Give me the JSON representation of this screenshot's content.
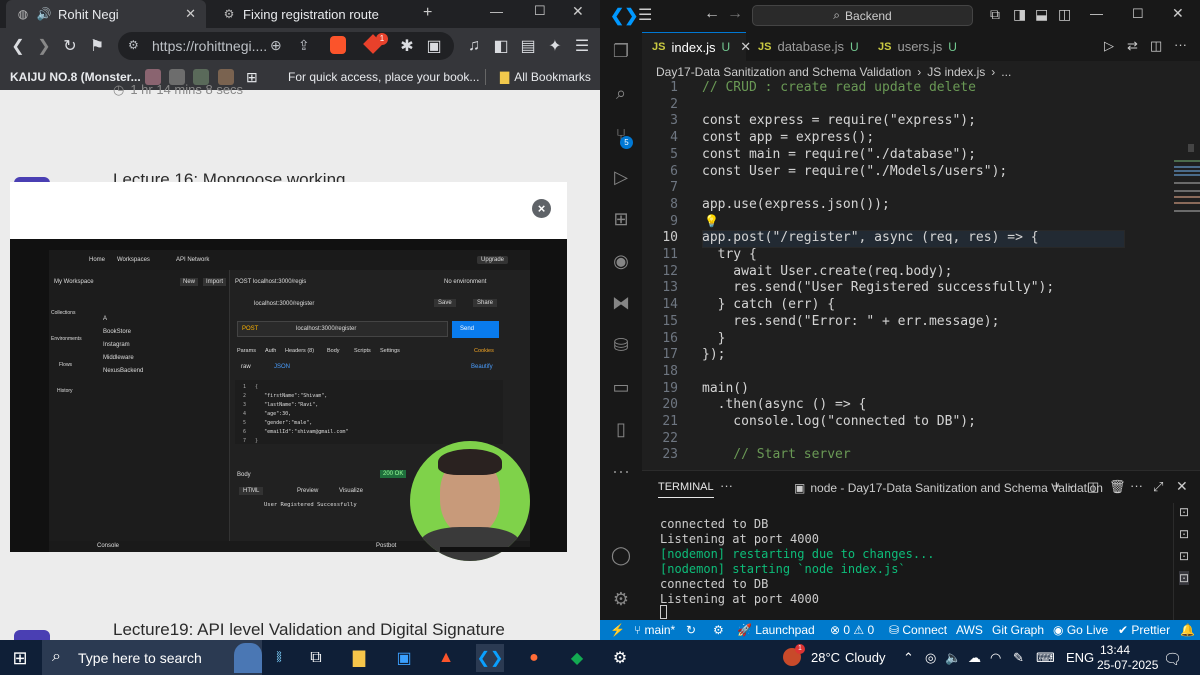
{
  "browser": {
    "tabs": [
      {
        "title": "Rohit Negi",
        "active": true
      },
      {
        "title": "Fixing registration route",
        "active": false
      }
    ],
    "new_tab": "+",
    "url": "https://rohittnegi....",
    "brave_badge": "1",
    "bookmarks": {
      "first": "KAIJU NO.8 (Monster...",
      "hint": "For quick access, place your book...",
      "all": "All Bookmarks"
    },
    "lectures": {
      "top_partial": "1 hr 14 mins 8 secs",
      "lecture16": "Lecture 16: Mongoose working",
      "lecture19": "Lecture19: API level Validation and Digital Signature"
    },
    "video": {
      "close": "×",
      "postman": {
        "nav": [
          "Home",
          "Workspaces",
          "API Network"
        ],
        "upgrade": "Upgrade",
        "workspace": "My Workspace",
        "new": "New",
        "import": "Import",
        "tab_title": "POST localhost:3000/regis",
        "environment": "No environment",
        "request_title": "localhost:3000/register",
        "save": "Save",
        "share": "Share",
        "sidebar": [
          "Collections",
          "Environments",
          "Flows",
          "History"
        ],
        "collections": [
          "A",
          "BookStore",
          "Instagram",
          "Middleware",
          "NexusBackend"
        ],
        "method": "POST",
        "request_url": "localhost:3000/register",
        "send": "Send",
        "req_tabs": [
          "Params",
          "Auth",
          "Headers (8)",
          "Body",
          "Scripts",
          "Settings"
        ],
        "cookies": "Cookies",
        "raw": "raw",
        "json": "JSON",
        "beautify": "Beautify",
        "body_lines": [
          "{",
          "\"firstName\":\"Shivam\",",
          "\"lastName\":\"Ravi\",",
          "\"age\":30,",
          "\"gender\":\"male\",",
          "\"emailId\":\"shivam@gmail.com\"",
          "}"
        ],
        "response_label": "Body",
        "status": "200 OK",
        "html": "HTML",
        "preview": "Preview",
        "visualize": "Visualize",
        "response_line": "User Registered Successfully",
        "console": "Console",
        "postbot": "Postbot"
      }
    }
  },
  "vscode": {
    "search": "Backend",
    "scm_badge": "5",
    "tabs": [
      {
        "name": "index.js",
        "status": "U",
        "active": true
      },
      {
        "name": "database.js",
        "status": "U",
        "active": false
      },
      {
        "name": "users.js",
        "status": "U",
        "active": false
      }
    ],
    "breadcrumb": [
      "Day17-Data Sanitization and Schema Validation",
      "JS index.js",
      "..."
    ],
    "editor_lines": [
      {
        "n": "1",
        "t": "// CRUD : create read update delete"
      },
      {
        "n": "2",
        "t": ""
      },
      {
        "n": "3",
        "t": "const express = require(\"express\");"
      },
      {
        "n": "4",
        "t": "const app = express();"
      },
      {
        "n": "5",
        "t": "const main = require(\"./database\");"
      },
      {
        "n": "6",
        "t": "const User = require(\"./Models/users\");"
      },
      {
        "n": "7",
        "t": ""
      },
      {
        "n": "8",
        "t": "app.use(express.json());"
      },
      {
        "n": "9",
        "t": ""
      },
      {
        "n": "10",
        "t": "app.post(\"/register\", async (req, res) => {"
      },
      {
        "n": "11",
        "t": "  try {"
      },
      {
        "n": "12",
        "t": "    await User.create(req.body);"
      },
      {
        "n": "13",
        "t": "    res.send(\"User Registered successfully\");"
      },
      {
        "n": "14",
        "t": "  } catch (err) {"
      },
      {
        "n": "15",
        "t": "    res.send(\"Error: \" + err.message);"
      },
      {
        "n": "16",
        "t": "  }"
      },
      {
        "n": "17",
        "t": "});"
      },
      {
        "n": "18",
        "t": ""
      },
      {
        "n": "19",
        "t": "main()"
      },
      {
        "n": "20",
        "t": "  .then(async () => {"
      },
      {
        "n": "21",
        "t": "    console.log(\"connected to DB\");"
      },
      {
        "n": "22",
        "t": ""
      },
      {
        "n": "23",
        "t": "    // Start server"
      }
    ],
    "current_line": "10",
    "terminal": {
      "tab_label": "TERMINAL",
      "more": "···",
      "session": "node - Day17-Data Sanitization and Schema Validation",
      "lines": [
        {
          "t": "connected to DB",
          "c": "plain"
        },
        {
          "t": "Listening at port 4000",
          "c": "plain"
        },
        {
          "t": "[nodemon] restarting due to changes...",
          "c": "green"
        },
        {
          "t": "[nodemon] starting `node index.js`",
          "c": "green"
        },
        {
          "t": "connected to DB",
          "c": "plain"
        },
        {
          "t": "Listening at port 4000",
          "c": "plain"
        }
      ]
    },
    "statusbar": {
      "branch": "main*",
      "launchpad": "Launchpad",
      "problems": "⊗ 0 ⚠ 0",
      "connect": "Connect",
      "aws": "AWS",
      "git_graph": "Git Graph",
      "go_live": "Go Live",
      "prettier": "Prettier"
    }
  },
  "taskbar": {
    "search_placeholder": "Type here to search",
    "weather_temp": "28°C",
    "weather_text": "Cloudy",
    "weather_badge": "1",
    "language": "ENG",
    "time": "13:44",
    "date": "25-07-2025"
  }
}
